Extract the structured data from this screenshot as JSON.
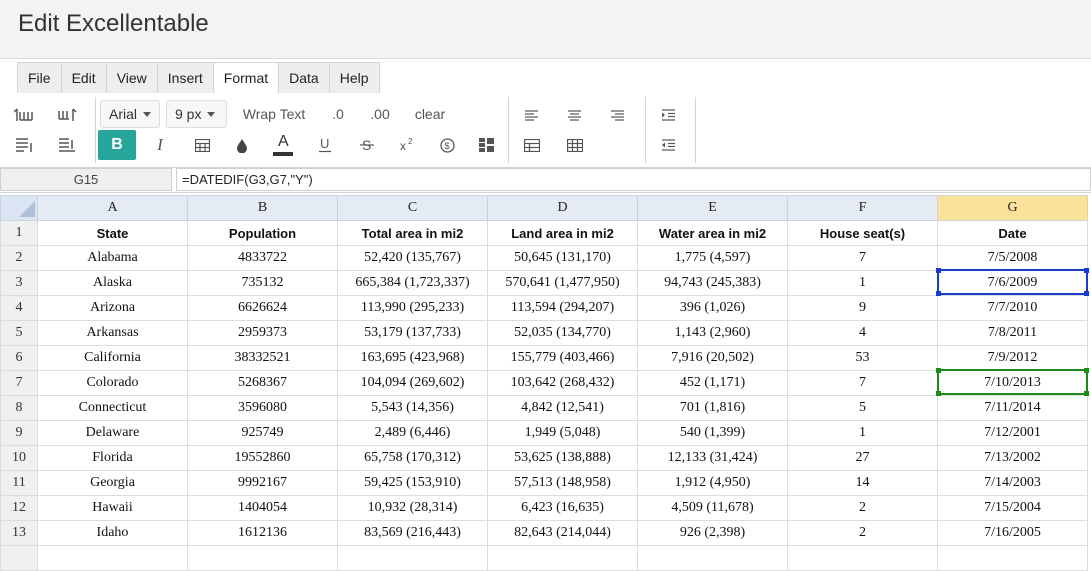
{
  "app": {
    "title": "Edit Excellentable"
  },
  "menu": [
    "File",
    "Edit",
    "View",
    "Insert",
    "Format",
    "Data",
    "Help"
  ],
  "menu_active": "Format",
  "toolbar": {
    "font": "Arial",
    "size": "9 px",
    "wrap": "Wrap Text",
    "dec_less": ".0",
    "dec_more": ".00",
    "clear": "clear",
    "bold": "B",
    "italic": "I"
  },
  "formula_bar": {
    "cell_ref": "G15",
    "formula": "=DATEDIF(G3,G7,\"Y\")"
  },
  "sheet": {
    "columns": [
      "A",
      "B",
      "C",
      "D",
      "E",
      "F",
      "G"
    ],
    "selected_column": "G",
    "row_numbers": [
      "1",
      "2",
      "3",
      "4",
      "5",
      "6",
      "7",
      "8",
      "9",
      "10",
      "11",
      "12",
      "13",
      ""
    ],
    "rows": [
      [
        "State",
        "Population",
        "Total area in mi2",
        "Land area in mi2",
        "Water area in mi2",
        "House seat(s)",
        "Date"
      ],
      [
        "Alabama",
        "4833722",
        "52,420 (135,767)",
        "50,645 (131,170)",
        "1,775 (4,597)",
        "7",
        "7/5/2008"
      ],
      [
        "Alaska",
        "735132",
        "665,384 (1,723,337)",
        "570,641 (1,477,950)",
        "94,743 (245,383)",
        "1",
        "7/6/2009"
      ],
      [
        "Arizona",
        "6626624",
        "113,990 (295,233)",
        "113,594 (294,207)",
        "396 (1,026)",
        "9",
        "7/7/2010"
      ],
      [
        "Arkansas",
        "2959373",
        "53,179 (137,733)",
        "52,035 (134,770)",
        "1,143 (2,960)",
        "4",
        "7/8/2011"
      ],
      [
        "California",
        "38332521",
        "163,695 (423,968)",
        "155,779 (403,466)",
        "7,916 (20,502)",
        "53",
        "7/9/2012"
      ],
      [
        "Colorado",
        "5268367",
        "104,094 (269,602)",
        "103,642 (268,432)",
        "452 (1,171)",
        "7",
        "7/10/2013"
      ],
      [
        "Connecticut",
        "3596080",
        "5,543 (14,356)",
        "4,842 (12,541)",
        "701 (1,816)",
        "5",
        "7/11/2014"
      ],
      [
        "Delaware",
        "925749",
        "2,489 (6,446)",
        "1,949 (5,048)",
        "540 (1,399)",
        "1",
        "7/12/2001"
      ],
      [
        "Florida",
        "19552860",
        "65,758 (170,312)",
        "53,625 (138,888)",
        "12,133 (31,424)",
        "27",
        "7/13/2002"
      ],
      [
        "Georgia",
        "9992167",
        "59,425 (153,910)",
        "57,513 (148,958)",
        "1,912 (4,950)",
        "14",
        "7/14/2003"
      ],
      [
        "Hawaii",
        "1404054",
        "10,932 (28,314)",
        "6,423 (16,635)",
        "4,509 (11,678)",
        "2",
        "7/15/2004"
      ],
      [
        "Idaho",
        "1612136",
        "83,569 (216,443)",
        "82,643 (214,044)",
        "926 (2,398)",
        "2",
        "7/16/2005"
      ],
      [
        "",
        "",
        "",
        "",
        "",
        "",
        ""
      ]
    ]
  },
  "colors": {
    "bold_active": "#26a69a",
    "select_blue": "#1a3cc8",
    "select_green": "#1e8a1e",
    "col_header": "#e4ebf5",
    "col_selected": "#fbe29a"
  }
}
